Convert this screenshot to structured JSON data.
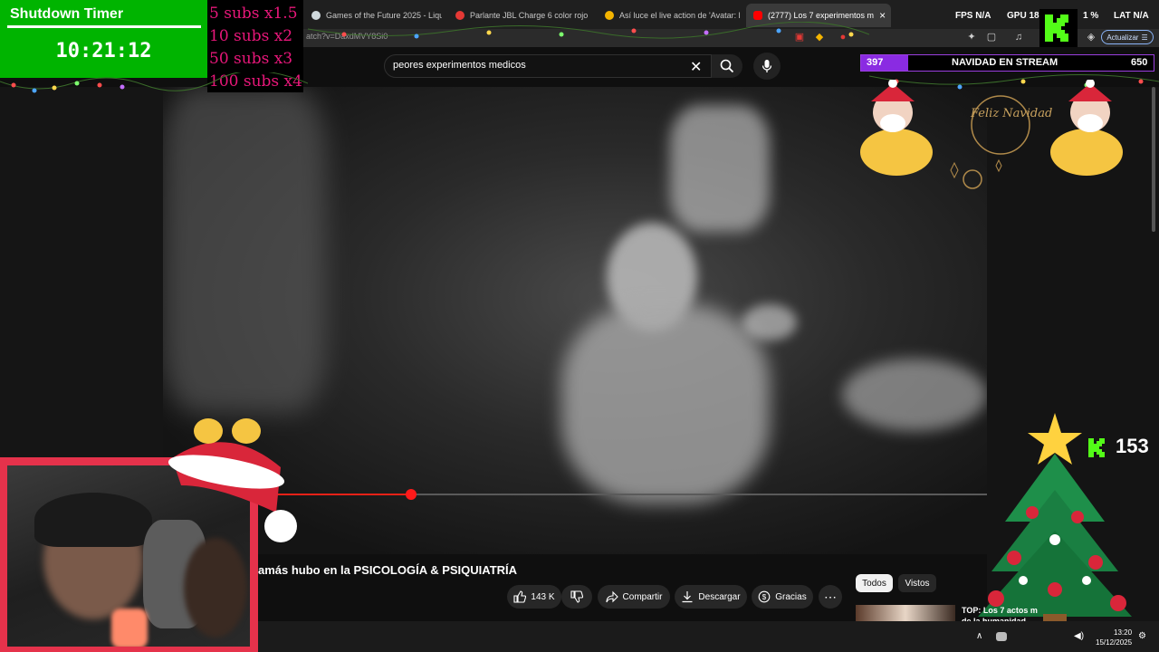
{
  "browser": {
    "tabs": [
      {
        "label": "Games of the Future 2025 - Liquiped",
        "favicon_color": "#cfd8dc"
      },
      {
        "label": "Parlante JBL Charge 6 color rojo | Cu",
        "favicon_color": "#e53935"
      },
      {
        "label": "Así luce el live action de 'Avatar: la le",
        "favicon_color": "#f4b400"
      },
      {
        "label": "(2777) Los 7 experimentos m",
        "favicon_color": "#ff0000",
        "active": true
      }
    ],
    "close_glyph": "×",
    "url_fragment": "atch?v=DaxdMVY8Si0",
    "update_button": "Actualizar"
  },
  "stats": {
    "fps_label": "FPS",
    "fps_value": "N/A",
    "gpu_label": "GPU",
    "gpu_value": "18",
    "percent": "1 %",
    "lat_label": "LAT",
    "lat_value": "N/A"
  },
  "youtube": {
    "search_value": "peores experimentos medicos",
    "clear_glyph": "✕",
    "video_title": "amás hubo en la PSICOLOGÍA & PSIQUIATRÍA",
    "progress": 0.21,
    "actions": {
      "likes": "143 K",
      "share": "Compartir",
      "download": "Descargar",
      "thanks": "Gracias",
      "more": "⋯"
    },
    "filter_chips": [
      "Todos",
      "Vistos"
    ],
    "recommended_title_1": "TOP: Los 7 actos m",
    "recommended_title_2": "de la humanidad"
  },
  "overlay": {
    "timer_title": "Shutdown Timer",
    "timer_value": "10:21:12",
    "subs": [
      "5 subs x1.5",
      "10 subs x2",
      "50 subs x3",
      "100 subs x4"
    ],
    "navidad_count_left": "397",
    "navidad_title": "NAVIDAD EN STREAM",
    "navidad_count_right": "650",
    "kick_letter": "K",
    "kick_viewers": "153",
    "feliz_navidad": "Feliz Navidad",
    "accent_green": "#53fc18",
    "timer_green": "#00b400",
    "subs_pink": "#e8177a"
  },
  "taskbar": {
    "time": "13:20",
    "date": "15/12/2025",
    "chevron": "∧"
  }
}
